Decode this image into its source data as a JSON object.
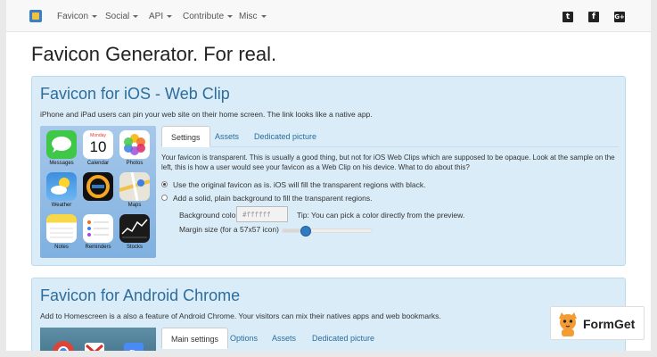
{
  "nav": {
    "items": [
      {
        "label": "Favicon"
      },
      {
        "label": "Social"
      },
      {
        "label": "API"
      },
      {
        "label": "Contribute"
      },
      {
        "label": "Misc"
      }
    ],
    "social_icons": [
      "twitter-icon",
      "facebook-icon",
      "google-plus-icon"
    ]
  },
  "page": {
    "title": "Favicon Generator. For real."
  },
  "ios": {
    "title": "Favicon for iOS - Web Clip",
    "description": "iPhone and iPad users can pin your web site on their home screen. The link looks like a native app.",
    "calendar": {
      "day": "Monday",
      "date": "10"
    },
    "apps": [
      {
        "label": "Messages",
        "color": "#3fc848"
      },
      {
        "label": "Calendar",
        "color": "#ffffff"
      },
      {
        "label": "Photos",
        "color": "#ffffff"
      },
      {
        "label": "Weather",
        "color": "#3b8fe0"
      },
      {
        "label": "",
        "color": "#111111"
      },
      {
        "label": "Maps",
        "color": "#e8e4d8"
      },
      {
        "label": "Notes",
        "color": "#f8d749"
      },
      {
        "label": "Reminders",
        "color": "#ffffff"
      },
      {
        "label": "Stocks",
        "color": "#1a1a1a"
      }
    ],
    "tabs": [
      {
        "label": "Settings",
        "active": true
      },
      {
        "label": "Assets",
        "active": false
      },
      {
        "label": "Dedicated picture",
        "active": false
      }
    ],
    "body_text": "Your favicon is transparent. This is usually a good thing, but not for iOS Web Clips which are supposed to be opaque. Look at the sample on the left, this is how a user would see your favicon as a Web Clip on his device. What to do about this?",
    "radio_original": "Use the original favicon as is. iOS will fill the transparent regions with black.",
    "radio_solid": "Add a solid, plain background to fill the transparent regions.",
    "bg_color_label": "Background color",
    "bg_color_value": "#ffffff",
    "tip": "Tip: You can pick a color directly from the preview.",
    "margin_label": "Margin size (for a 57x57 icon)",
    "margin_fraction": 0.26
  },
  "android": {
    "title": "Favicon for Android Chrome",
    "description": "Add to Homescreen is a also a feature of Android Chrome. Your visitors can mix their natives apps and web bookmarks.",
    "tabs": [
      {
        "label": "Main settings",
        "active": true
      },
      {
        "label": "Options",
        "active": false
      },
      {
        "label": "Assets",
        "active": false
      },
      {
        "label": "Dedicated picture",
        "active": false
      }
    ]
  },
  "badge": {
    "text": "FormGet"
  },
  "colors": {
    "accent": "#2c6d9e",
    "panel_bg": "#d9ecf7",
    "slider": "#2e7bc4"
  }
}
